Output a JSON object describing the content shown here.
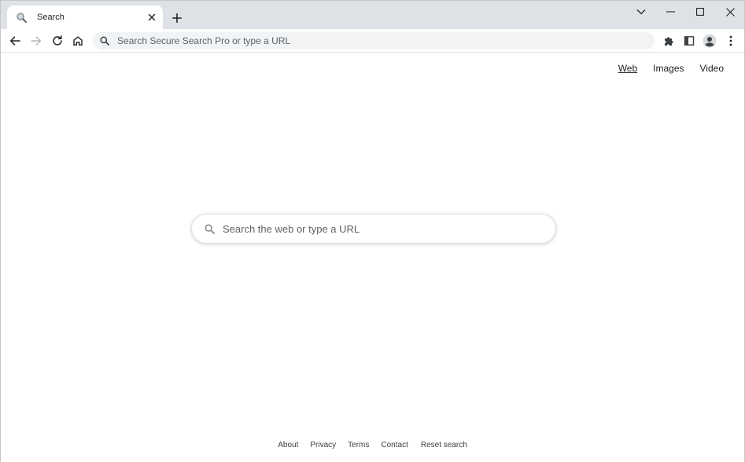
{
  "tab": {
    "title": "Search"
  },
  "toolbar": {
    "omnibox_placeholder": "Search Secure Search Pro or type a URL"
  },
  "topnav": {
    "items": [
      "Web",
      "Images",
      "Video"
    ]
  },
  "search": {
    "placeholder": "Search the web or type a URL"
  },
  "footer": {
    "links": [
      "About",
      "Privacy",
      "Terms",
      "Contact",
      "Reset search"
    ]
  },
  "colors": {
    "tabstrip_bg": "#dee1e6",
    "omnibox_bg": "#f1f3f4",
    "icon": "#5f6368"
  }
}
